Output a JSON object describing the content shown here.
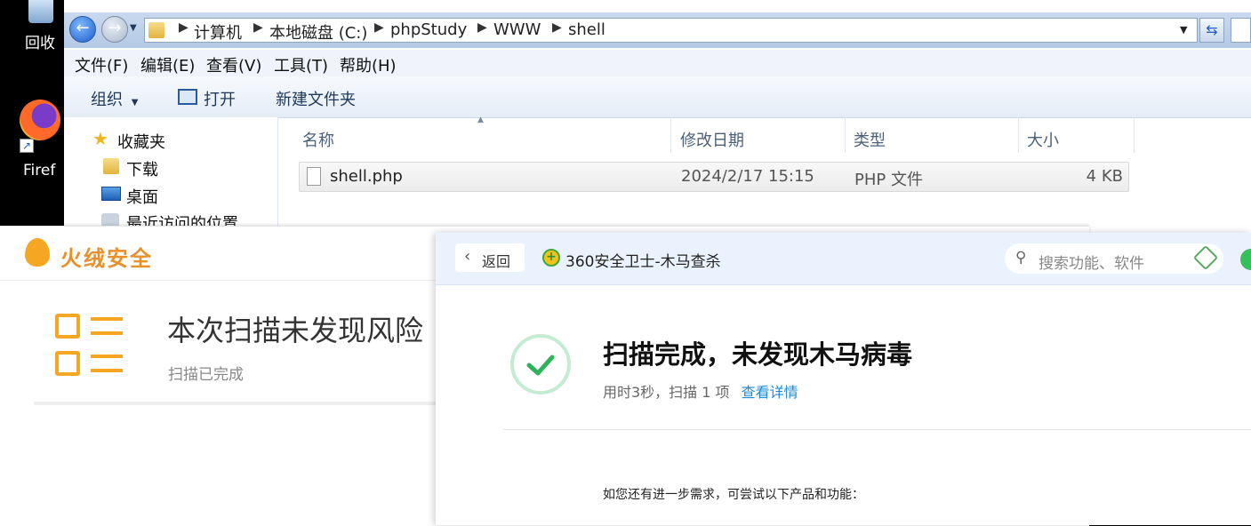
{
  "desktop": {
    "recycle_label": "回收",
    "firefox_label": "Firef"
  },
  "explorer": {
    "breadcrumb": [
      "计算机",
      "本地磁盘 (C:)",
      "phpStudy",
      "WWW",
      "shell"
    ],
    "menu": [
      "文件(F)",
      "编辑(E)",
      "查看(V)",
      "工具(T)",
      "帮助(H)"
    ],
    "toolbar": {
      "organize": "组织",
      "open": "打开",
      "new_folder": "新建文件夹"
    },
    "nav": [
      "收藏夹",
      "下载",
      "桌面",
      "最近访问的位置"
    ],
    "columns": {
      "name": "名称",
      "date": "修改日期",
      "type": "类型",
      "size": "大小"
    },
    "files": [
      {
        "name": "shell.php",
        "date": "2024/2/17 15:15",
        "type": "PHP 文件",
        "size": "4 KB"
      }
    ]
  },
  "huorong": {
    "brand": "火绒安全",
    "result_title": "本次扫描未发现风险",
    "result_sub": "扫描已完成"
  },
  "q360": {
    "back": "返回",
    "app_title": "360安全卫士-木马查杀",
    "search_placeholder": "搜索功能、软件",
    "result_title": "扫描完成，未发现木马病毒",
    "result_detail": "用时3秒，扫描 1 项",
    "detail_link": "查看详情",
    "suggest": "如您还有进一步需求，可尝试以下产品和功能："
  },
  "colors": {
    "huorong_orange": "#f5a623",
    "q360_green": "#2fb35a",
    "link_blue": "#1e8ad2"
  }
}
